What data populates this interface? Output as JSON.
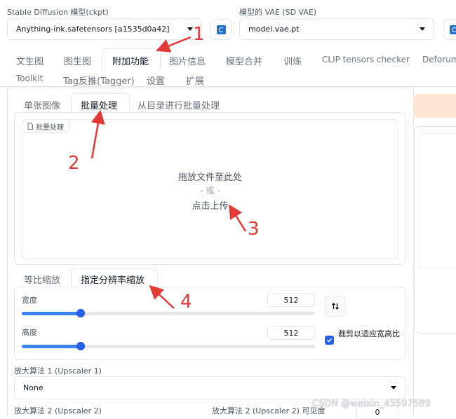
{
  "models": {
    "ckpt_label": "Stable Diffusion 模型(ckpt)",
    "ckpt_value": "Anything-ink.safetensors [a1535d0a42]",
    "vae_label": "模型的 VAE (SD VAE)",
    "vae_value": "model.vae.pt"
  },
  "main_tabs": [
    "文生图",
    "图生图",
    "附加功能",
    "图片信息",
    "模型合并",
    "训练",
    "CLIP tensors checker",
    "Deforum"
  ],
  "main_tabs_row2": [
    "Toolkit",
    "Tag反推(Tagger)",
    "设置",
    "扩展"
  ],
  "sub_tabs": [
    "单张图像",
    "批量处理",
    "从目录进行批量处理"
  ],
  "upload": {
    "label": "批量处理",
    "line1": "拖放文件至此处",
    "line2": "- 或 -",
    "line3": "点击上传"
  },
  "scale_tabs": [
    "等比缩放",
    "指定分辨率缩放"
  ],
  "width": {
    "label": "宽度",
    "value": "512",
    "fraction": 0.2
  },
  "height": {
    "label": "高度",
    "value": "512",
    "fraction": 0.2
  },
  "crop_label": "裁剪以适应宽高比",
  "upscaler1": {
    "label": "放大算法 1 (Upscaler 1)",
    "value": "None"
  },
  "upscaler2_label": "放大算法 2 (Upscaler 2)",
  "upscaler2_vis_label": "放大算法 2 (Upscaler 2) 可见度",
  "upscaler2_vis_value": "0",
  "annotations": [
    "1",
    "2",
    "3",
    "4"
  ],
  "watermark": "CSDN @weixin_45597589",
  "colors": {
    "accent": "#2563eb",
    "annotation": "#e53935",
    "generate": "#fde7d2"
  }
}
